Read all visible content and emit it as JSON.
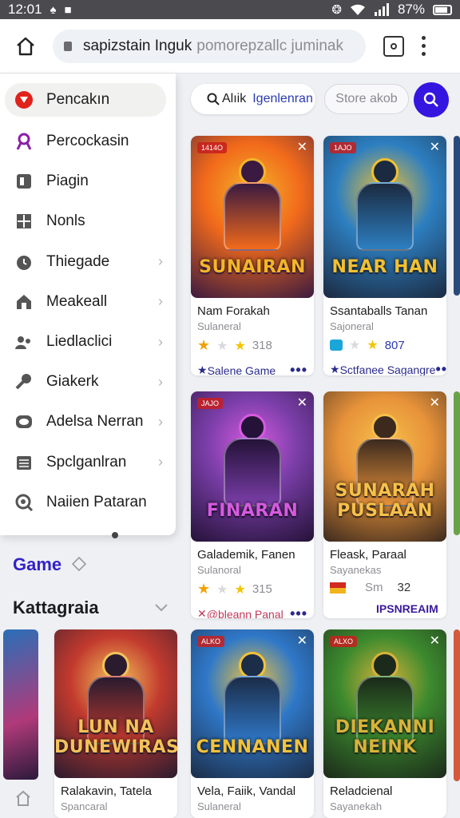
{
  "status": {
    "time": "12:01",
    "battery": "87%"
  },
  "browser": {
    "url_host": "sapizstain Inguk",
    "url_path": "pomorepzallc juminak"
  },
  "drawer": {
    "items": [
      {
        "label": "Pencakın",
        "icon": "youtube-icon"
      },
      {
        "label": "Percockasin",
        "icon": "ribbon-icon"
      },
      {
        "label": "Piagin",
        "icon": "puzzle-icon"
      },
      {
        "label": "Nonls",
        "icon": "grid-icon"
      },
      {
        "label": "Thiegade",
        "icon": "timer-icon"
      },
      {
        "label": "Meakeall",
        "icon": "house-icon"
      },
      {
        "label": "Liedlaclici",
        "icon": "people-icon"
      },
      {
        "label": "Giakerk",
        "icon": "wrench-icon"
      },
      {
        "label": "Adelsa Nerran",
        "icon": "eye-icon"
      },
      {
        "label": "Spclganlran",
        "icon": "calendar-icon"
      },
      {
        "label": "Naiien Pataran",
        "icon": "refresh-search-icon"
      }
    ]
  },
  "search": {
    "prefix": "Alıik",
    "query": "Igenlenran",
    "store": "Store akob"
  },
  "sections": {
    "game": "Game",
    "category": "Kattagraia"
  },
  "cards": [
    {
      "badge": "1414O",
      "logo": "SUNAIRAN",
      "title": "Nam Forakah",
      "sub": "Sulaneral",
      "rating": "318",
      "footer": "Salene Game",
      "colors": [
        "#f26a1b",
        "#3a1a40",
        "#f3b52a"
      ]
    },
    {
      "badge": "1AJO",
      "logo": "NEAR HAN",
      "title": "Ssantaballs Tanan",
      "sub": "Sajoneral",
      "rating": "807",
      "footer": "Sctfanee Sagangre",
      "colors": [
        "#2d7fc1",
        "#1b2a40",
        "#f2c030"
      ]
    },
    {
      "badge": "JAJO",
      "logo": "FINARAN",
      "title": "Galademik, Fanen",
      "sub": "Sulanoral",
      "rating": "315",
      "footer": "@bleann Panal",
      "colors": [
        "#7a3ea8",
        "#241238",
        "#d65ae0"
      ]
    },
    {
      "badge": "",
      "logo": "SUNARAH PUSLAAN",
      "title": "Fleask, Paraal",
      "sub": "Sayanekas",
      "rating": "32",
      "extra": "Sm",
      "footer": "IPSNREAIM",
      "colors": [
        "#e8933a",
        "#3c2a1e",
        "#f6c04a"
      ]
    }
  ],
  "bottom_cards": [
    {
      "logo": "LUN NA DUNEWIRAS",
      "title": "Ralakavin, Tatela",
      "sub": "Spancaral",
      "colors": [
        "#c23a2e",
        "#2a1b2f",
        "#f3c25a"
      ]
    },
    {
      "badge": "ALKO",
      "logo": "CENNANEN",
      "title": "Vela, Faiik, Vandal",
      "sub": "Sulaneral",
      "colors": [
        "#2f78c8",
        "#1c2d48",
        "#f2c23a"
      ]
    },
    {
      "badge": "ALXO",
      "logo": "DIEKANNI NEINK",
      "title": "Reladcienal",
      "sub": "Sayanekah",
      "colors": [
        "#3c8a2e",
        "#1b2a1a",
        "#d8b23a"
      ]
    }
  ],
  "accent": "#3416e0"
}
